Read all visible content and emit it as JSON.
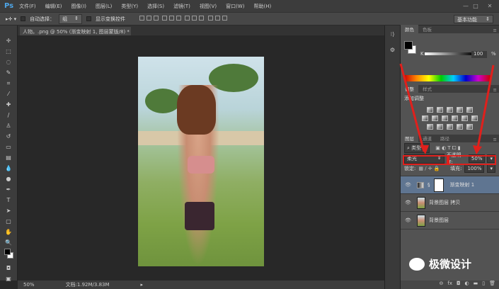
{
  "app": {
    "logo": "Ps",
    "menus": [
      "文件(F)",
      "编辑(E)",
      "图像(I)",
      "图层(L)",
      "类型(Y)",
      "选择(S)",
      "滤镜(T)",
      "视图(V)",
      "窗口(W)",
      "帮助(H)"
    ],
    "window_controls": [
      "—",
      "□",
      "✕"
    ]
  },
  "options": {
    "auto_select_label": "自动选择：",
    "auto_select_value": "组",
    "show_transform_label": "显示变换控件",
    "workspace": "基本功能"
  },
  "document": {
    "tab_title": "人物。.png @ 50% (渐变映射 1, 图层蒙版/8) *",
    "close": "×"
  },
  "status": {
    "zoom": "50%",
    "doc_info": "文档:1.92M/3.83M"
  },
  "color_panel": {
    "tabs": [
      "颜色",
      "色板"
    ],
    "channel": "K",
    "value": "100",
    "unit": "%",
    "fg": "#000000",
    "bg": "#ffffff"
  },
  "adjust_panel": {
    "tabs": [
      "调整",
      "样式"
    ],
    "title": "添加调整"
  },
  "layers_panel": {
    "tabs": [
      "图层",
      "通道",
      "路径"
    ],
    "filter": "类型",
    "blend_mode": "柔光",
    "opacity_label": "不透明度:",
    "opacity": "50%",
    "lock_label": "锁定:",
    "fill_label": "填充:",
    "fill": "100%",
    "layers": [
      {
        "name": "渐变映射 1",
        "selected": true
      },
      {
        "name": "背景图层 拷贝",
        "selected": false
      },
      {
        "name": "背景图层",
        "selected": false
      }
    ],
    "footer_icons": [
      "link-icon",
      "fx-icon",
      "mask-icon",
      "adjustment-icon",
      "folder-icon",
      "new-layer-icon",
      "trash-icon"
    ]
  },
  "watermark": "极微设计",
  "annotation_color": "#e0201c"
}
